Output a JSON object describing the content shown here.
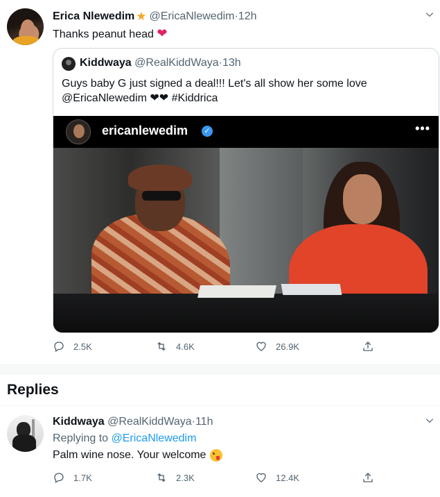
{
  "tweet": {
    "author_name": "Erica Nlewedim",
    "author_handle": "@EricaNlewedim",
    "separator": " · ",
    "time": "12h",
    "star_icon": "star-icon",
    "text": "Thanks peanut head",
    "emoji": "❤",
    "quote": {
      "author_name": "Kiddwaya",
      "author_handle": "@RealKiddWaya",
      "separator": " · ",
      "time": "13h",
      "text_line1": "Guys baby G just signed a deal!!! Let's all show her some love",
      "text_line2": "@EricaNlewedim ❤❤ #Kiddrica",
      "media": {
        "ig_username": "ericanlewedim",
        "ig_verified_mark": "✓",
        "ig_more": "•••"
      }
    },
    "actions": {
      "reply_count": "2.5K",
      "retweet_count": "4.6K",
      "like_count": "26.9K"
    }
  },
  "replies_section": {
    "title": "Replies"
  },
  "reply": {
    "author_name": "Kiddwaya",
    "author_handle": "@RealKiddWaya",
    "separator": " · ",
    "time": "11h",
    "replying_label": "Replying to ",
    "replying_handle": "@EricaNlewedim",
    "text": "Palm wine nose. Your welcome",
    "actions": {
      "reply_count": "1.7K",
      "retweet_count": "2.3K",
      "like_count": "12.4K"
    }
  },
  "colors": {
    "link": "#1d9bf0",
    "muted": "#536471",
    "heart": "#e0245e",
    "star": "#f5a623"
  }
}
